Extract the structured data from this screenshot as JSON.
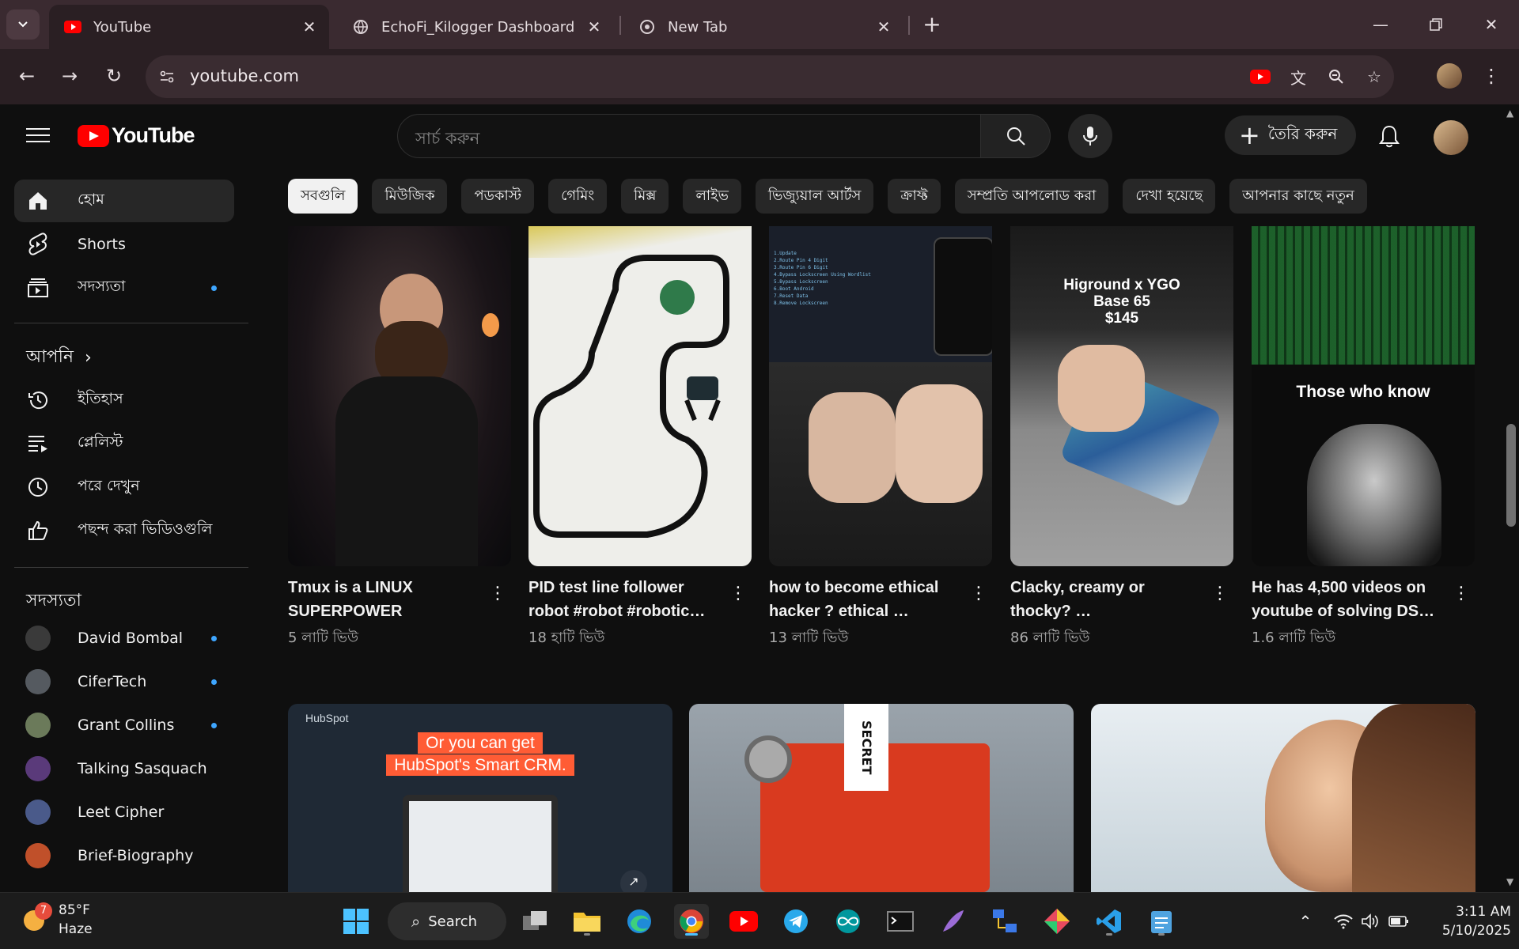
{
  "browser": {
    "tabs": [
      {
        "title": "YouTube",
        "active": true
      },
      {
        "title": "EchoFi_Kilogger Dashboard",
        "active": false
      },
      {
        "title": "New Tab",
        "active": false
      }
    ],
    "url": "youtube.com"
  },
  "youtube": {
    "logo_text": "YouTube",
    "search_placeholder": "সার্চ করুন",
    "create_label": "তৈরি করুন"
  },
  "sidebar": {
    "main": [
      {
        "label": "হোম",
        "icon": "home-icon"
      },
      {
        "label": "Shorts",
        "icon": "shorts-icon"
      },
      {
        "label": "সদস্যতা",
        "icon": "subscriptions-icon"
      }
    ],
    "you_heading": "আপনি",
    "you": [
      {
        "label": "ইতিহাস",
        "icon": "history-icon"
      },
      {
        "label": "প্লেলিস্ট",
        "icon": "playlist-icon"
      },
      {
        "label": "পরে দেখুন",
        "icon": "watch-later-icon"
      },
      {
        "label": "পছন্দ করা ভিডিওগুলি",
        "icon": "like-icon"
      }
    ],
    "subs_heading": "সদস্যতা",
    "subscriptions": [
      {
        "name": "David Bombal",
        "color": "#3a3a3a",
        "dot": true
      },
      {
        "name": "CiferTech",
        "color": "#555a60",
        "dot": true
      },
      {
        "name": "Grant Collins",
        "color": "#6b7a5a",
        "dot": true
      },
      {
        "name": "Talking Sasquach",
        "color": "#5a3a7a",
        "dot": false
      },
      {
        "name": "Leet Cipher",
        "color": "#4a5a8a",
        "dot": false
      },
      {
        "name": "Brief-Biography",
        "color": "#c0502a",
        "dot": false
      }
    ]
  },
  "chips": [
    {
      "label": "সবগুলি",
      "active": true
    },
    {
      "label": "মিউজিক",
      "active": false
    },
    {
      "label": "পডকাস্ট",
      "active": false
    },
    {
      "label": "গেমিং",
      "active": false
    },
    {
      "label": "মিক্স",
      "active": false
    },
    {
      "label": "লাইভ",
      "active": false
    },
    {
      "label": "ভিজ্যুয়াল আর্টস",
      "active": false
    },
    {
      "label": "ক্রাফ্ট",
      "active": false
    },
    {
      "label": "সম্প্রতি আপলোড করা",
      "active": false
    },
    {
      "label": "দেখা হয়েছে",
      "active": false
    },
    {
      "label": "আপনার কাছে নতুন",
      "active": false
    }
  ],
  "shorts": [
    {
      "title": "Tmux is a LINUX SUPERPOWER",
      "views": "5 লাটি ভিউ"
    },
    {
      "title": "PID test line follower robot #robot #robotic…",
      "views": "18 হাটি ভিউ"
    },
    {
      "title": "how to become ethical hacker ? ethical …",
      "views": "13 লাটি ভিউ"
    },
    {
      "title": "Clacky, creamy or thocky? …",
      "views": "86 লাটি ভিউ",
      "overlay": [
        "Higround x YGO",
        "Base 65",
        "$145"
      ]
    },
    {
      "title": "He has 4,500 videos on youtube of solving DS…",
      "views": "1.6 লাটি ভিউ",
      "overlay_text": "Those who know"
    }
  ],
  "videos": [
    {
      "brand": "HubSpot",
      "headline_1": "Or you can get",
      "headline_2": "HubSpot's Smart CRM."
    },
    {
      "label_text": "SECRET"
    },
    {}
  ],
  "taskbar": {
    "weather_temp": "85°F",
    "weather_desc": "Haze",
    "weather_badge": "7",
    "search_label": "Search",
    "time": "3:11 AM",
    "date": "5/10/2025"
  }
}
